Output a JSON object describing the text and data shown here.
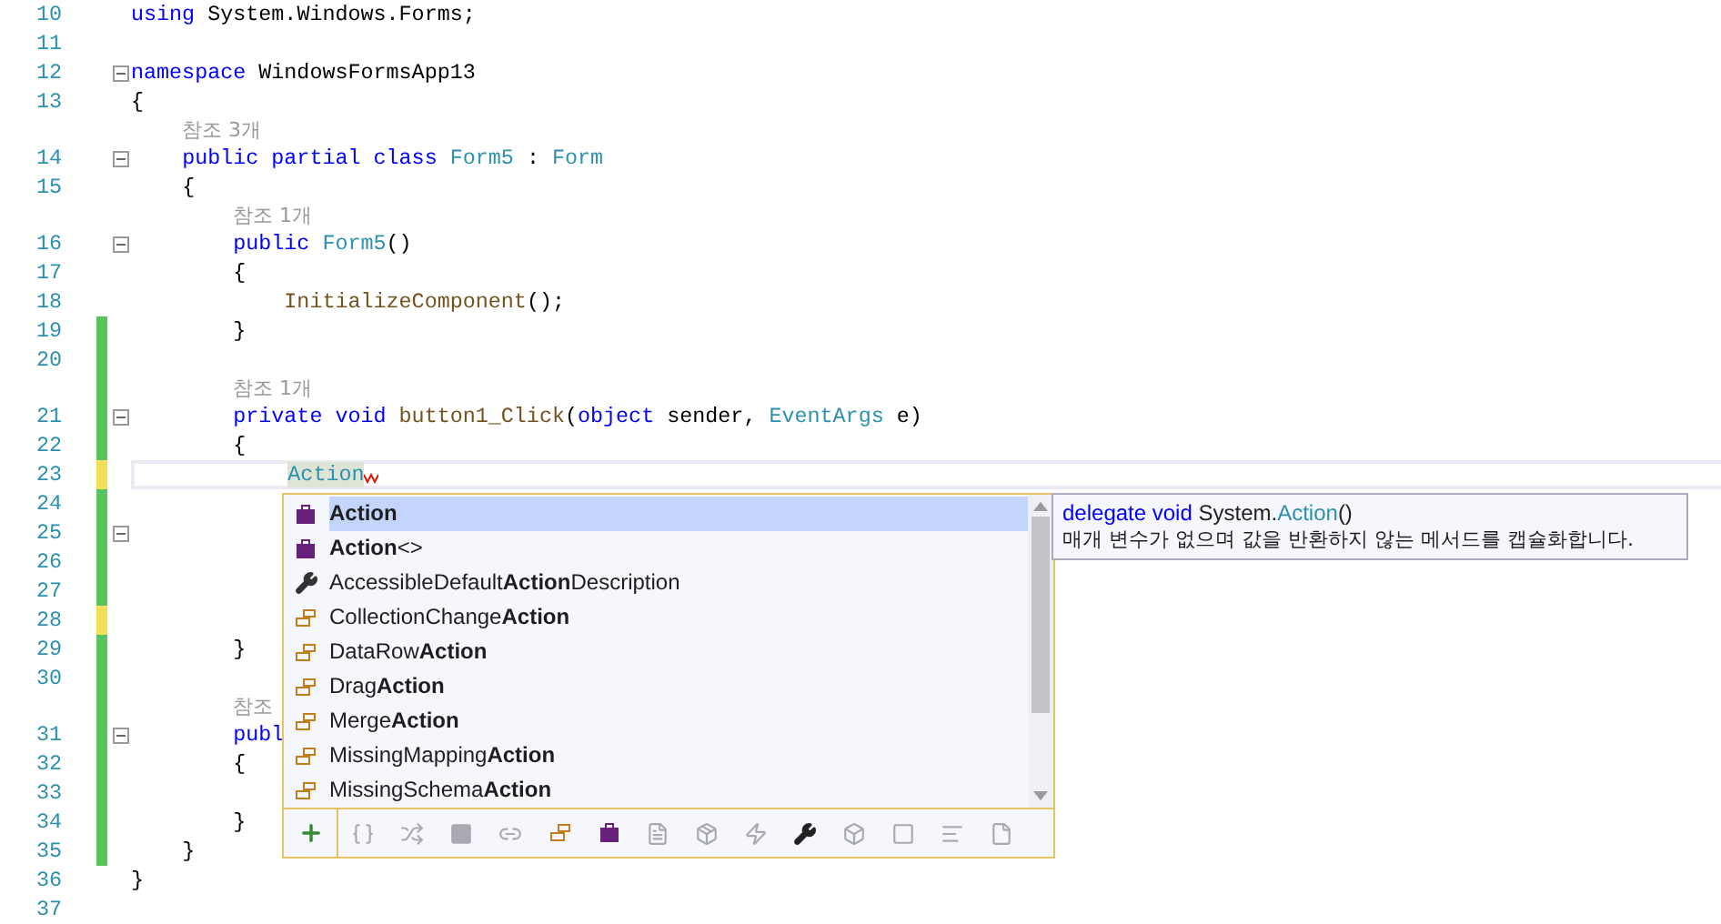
{
  "editor": {
    "lines": [
      {
        "number": "10",
        "fold": false,
        "tokens": [
          {
            "text": "using",
            "kind": "keyword"
          },
          {
            "text": " System.Windows.Forms;",
            "kind": "plain"
          }
        ]
      },
      {
        "number": "11",
        "fold": false
      },
      {
        "number": "12",
        "fold": true,
        "tokens": [
          {
            "text": "namespace",
            "kind": "keyword"
          },
          {
            "text": " WindowsFormsApp13",
            "kind": "plain"
          }
        ]
      },
      {
        "number": "13",
        "fold": false,
        "tokens": [
          {
            "text": "{",
            "kind": "plain"
          }
        ]
      },
      {
        "number": "14",
        "fold": true,
        "lens": "참조 3개",
        "tokens": [
          {
            "text": "    public partial class",
            "kind": "keyword"
          },
          {
            "text": " Form5",
            "kind": "type"
          },
          {
            "text": " : ",
            "kind": "plain"
          },
          {
            "text": "Form",
            "kind": "type"
          }
        ]
      },
      {
        "number": "15",
        "fold": false,
        "tokens": [
          {
            "text": "    {",
            "kind": "plain"
          }
        ]
      },
      {
        "number": "16",
        "fold": true,
        "lens": "참조 1개",
        "tokens": [
          {
            "text": "        public",
            "kind": "keyword"
          },
          {
            "text": " Form5",
            "kind": "type"
          },
          {
            "text": "()",
            "kind": "plain"
          }
        ]
      },
      {
        "number": "17",
        "fold": false,
        "tokens": [
          {
            "text": "        {",
            "kind": "plain"
          }
        ]
      },
      {
        "number": "18",
        "fold": false,
        "tokens": [
          {
            "text": "            InitializeComponent",
            "kind": "method"
          },
          {
            "text": "();",
            "kind": "plain"
          }
        ]
      },
      {
        "number": "19",
        "fold": false,
        "color": "#57c55e",
        "tokens": [
          {
            "text": "        }",
            "kind": "plain"
          }
        ]
      },
      {
        "number": "20",
        "fold": false,
        "color": "#57c55e"
      },
      {
        "number": "21",
        "fold": true,
        "color": "#57c55e",
        "lens": "참조 1개",
        "tokens": [
          {
            "text": "        private void",
            "kind": "keyword"
          },
          {
            "text": " button1_Click",
            "kind": "method"
          },
          {
            "text": "(",
            "kind": "plain"
          },
          {
            "text": "object",
            "kind": "keyword"
          },
          {
            "text": " sender, ",
            "kind": "plain"
          },
          {
            "text": "EventArgs",
            "kind": "type"
          },
          {
            "text": " e)",
            "kind": "plain"
          }
        ]
      },
      {
        "number": "22",
        "fold": false,
        "color": "#57c55e",
        "tokens": [
          {
            "text": "        {",
            "kind": "plain"
          }
        ]
      },
      {
        "number": "23",
        "fold": false,
        "color": "#f2df5a",
        "current": true,
        "tokens": [
          {
            "text": "            Action",
            "kind": "typed"
          }
        ]
      },
      {
        "number": "24",
        "fold": false,
        "color": "#57c55e"
      },
      {
        "number": "25",
        "fold": true,
        "color": "#57c55e"
      },
      {
        "number": "26",
        "fold": false,
        "color": "#57c55e"
      },
      {
        "number": "27",
        "fold": false,
        "color": "#57c55e"
      },
      {
        "number": "28",
        "fold": false,
        "color": "#f2df5a"
      },
      {
        "number": "29",
        "fold": false,
        "color": "#57c55e",
        "tokens": [
          {
            "text": "        }",
            "kind": "plain"
          }
        ]
      },
      {
        "number": "30",
        "fold": false,
        "color": "#57c55e"
      },
      {
        "number": "31",
        "fold": true,
        "color": "#57c55e",
        "lens": "참조",
        "tokens": [
          {
            "text": "        publ",
            "kind": "keyword"
          }
        ]
      },
      {
        "number": "32",
        "fold": false,
        "color": "#57c55e",
        "tokens": [
          {
            "text": "        {",
            "kind": "plain"
          }
        ]
      },
      {
        "number": "33",
        "fold": false,
        "color": "#57c55e"
      },
      {
        "number": "34",
        "fold": false,
        "color": "#57c55e",
        "tokens": [
          {
            "text": "        }",
            "kind": "plain"
          }
        ]
      },
      {
        "number": "35",
        "fold": false,
        "color": "#57c55e",
        "tokens": [
          {
            "text": "    }",
            "kind": "plain"
          }
        ]
      },
      {
        "number": "36",
        "fold": false,
        "tokens": [
          {
            "text": "}",
            "kind": "plain"
          }
        ]
      },
      {
        "number": "37",
        "fold": false
      }
    ]
  },
  "completion": {
    "items": [
      {
        "label": "**Action**",
        "kind": "class",
        "selected": true
      },
      {
        "label": "**Action**<>",
        "kind": "class",
        "selected": false
      },
      {
        "label": "AccessibleDefault**Action**Description",
        "kind": "property",
        "selected": false
      },
      {
        "label": "CollectionChange**Action**",
        "kind": "enum",
        "selected": false
      },
      {
        "label": "DataRow**Action**",
        "kind": "enum",
        "selected": false
      },
      {
        "label": "Drag**Action**",
        "kind": "enum",
        "selected": false
      },
      {
        "label": "Merge**Action**",
        "kind": "enum",
        "selected": false
      },
      {
        "label": "MissingMapping**Action**",
        "kind": "enum",
        "selected": false
      },
      {
        "label": "MissingSchema**Action**",
        "kind": "enum",
        "selected": false
      }
    ],
    "filters": [
      {
        "kind": "expander",
        "enabled": true
      },
      {
        "kind": "namespace",
        "enabled": false
      },
      {
        "kind": "extension",
        "enabled": false
      },
      {
        "kind": "module",
        "enabled": false
      },
      {
        "kind": "interface",
        "enabled": false
      },
      {
        "kind": "enum",
        "enabled": true
      },
      {
        "kind": "class",
        "enabled": true
      },
      {
        "kind": "text",
        "enabled": false
      },
      {
        "kind": "structure",
        "enabled": false
      },
      {
        "kind": "event",
        "enabled": false
      },
      {
        "kind": "property",
        "enabled": true
      },
      {
        "kind": "cube",
        "enabled": false
      },
      {
        "kind": "snippet",
        "enabled": false
      },
      {
        "kind": "lines",
        "enabled": false
      },
      {
        "kind": "page",
        "enabled": false
      }
    ]
  },
  "tooltip": {
    "signature": [
      {
        "text": "delegate void",
        "kind": "keyword"
      },
      {
        "text": " System.",
        "kind": "plain"
      },
      {
        "text": "Action",
        "kind": "type"
      },
      {
        "text": "()",
        "kind": "plain"
      }
    ],
    "description": "매개 변수가 없으며 값을 반환하지 않는 메서드를 캡슐화합니다."
  }
}
